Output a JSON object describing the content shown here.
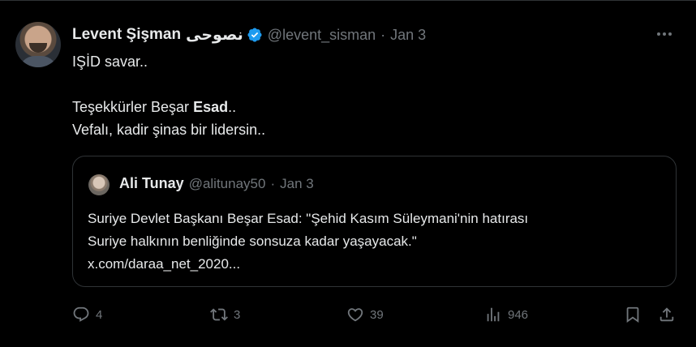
{
  "author": {
    "name": "Levent Şişman",
    "name_extra": "نصوحى",
    "handle": "@levent_sisman",
    "date": "Jan 3",
    "verified": true
  },
  "tweet": {
    "line1": "IŞİD savar..",
    "line2_prefix": "Teşekkürler Beşar ",
    "line2_bold": "Esad",
    "line2_suffix": "..",
    "line3": "Vefalı, kadir şinas bir lidersin.."
  },
  "quoted": {
    "name": "Ali Tunay",
    "handle": "@alitunay50",
    "date": "Jan 3",
    "line1": "Suriye Devlet Başkanı Beşar Esad: \"Şehid Kasım Süleymani'nin hatırası",
    "line2": "Suriye halkının benliğinde sonsuza kadar yaşayacak.\"",
    "link": "x.com/daraa_net_2020..."
  },
  "actions": {
    "replies": "4",
    "reposts": "3",
    "likes": "39",
    "views": "946"
  },
  "colors": {
    "background": "#000000",
    "text": "#e7e9ea",
    "secondary": "#71767b",
    "verified": "#1d9bf0",
    "border": "#2f3336"
  }
}
